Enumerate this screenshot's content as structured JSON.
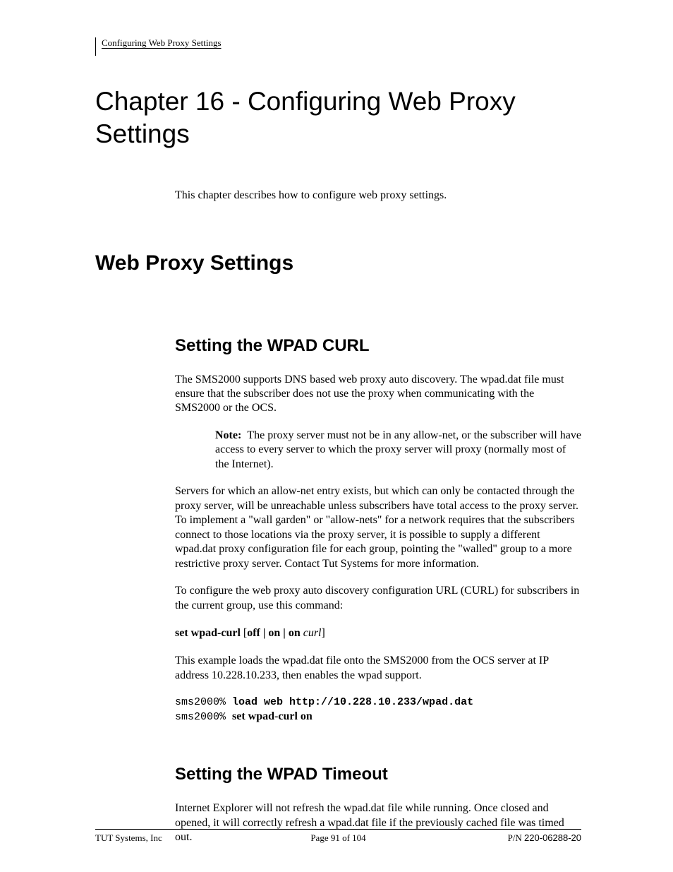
{
  "header": {
    "running_head": "Configuring Web Proxy Settings"
  },
  "chapter": {
    "title": "Chapter 16 - Configuring Web Proxy Settings",
    "intro": "This chapter describes how to configure web proxy settings."
  },
  "section": {
    "title": "Web Proxy Settings"
  },
  "sub1": {
    "title": "Setting the WPAD CURL",
    "p1": "The SMS2000 supports DNS based web proxy auto discovery. The wpad.dat file must ensure that the subscriber does not use the proxy when communicating with the SMS2000 or the OCS.",
    "note_label": "Note:",
    "note_body": "The proxy server must not be in any allow-net, or the subscriber will have access to every server to which the proxy server will proxy (normally most of the Internet).",
    "p2": "Servers for which an allow-net entry exists, but which can only be contacted through the proxy server, will be unreachable unless subscribers have total access to the proxy server. To implement a \"wall garden\" or \"allow-nets\" for a network requires that the subscribers connect to those locations via the proxy server, it is possible to supply a different wpad.dat proxy configuration file for each group, pointing the \"walled\" group to a more restrictive proxy server. Contact Tut Systems for more information.",
    "p3": "To configure the web proxy auto discovery configuration URL (CURL) for subscribers in the current group, use this command:",
    "cmd_bold1": "set wpad-curl",
    "cmd_br1": " [",
    "cmd_bold2": "off | on | on",
    "cmd_it": " curl",
    "cmd_br2": "]",
    "p4": "This example loads the wpad.dat file onto the SMS2000 from the OCS server at IP address 10.228.10.233, then enables the wpad support.",
    "cli1_prompt": "sms2000% ",
    "cli1_cmd": "load web http://10.228.10.233/wpad.dat",
    "cli2_prompt": "sms2000% ",
    "cli2_cmd": "set wpad-curl on"
  },
  "sub2": {
    "title": "Setting the WPAD Timeout",
    "p1": "Internet Explorer will not refresh the wpad.dat file while running. Once closed and opened, it will correctly refresh a wpad.dat file if the previously cached file was timed out."
  },
  "footer": {
    "left": "TUT Systems, Inc",
    "center": "Page 91 of 104",
    "pn_label": "P/N ",
    "pn_value": "220-06288-20"
  }
}
